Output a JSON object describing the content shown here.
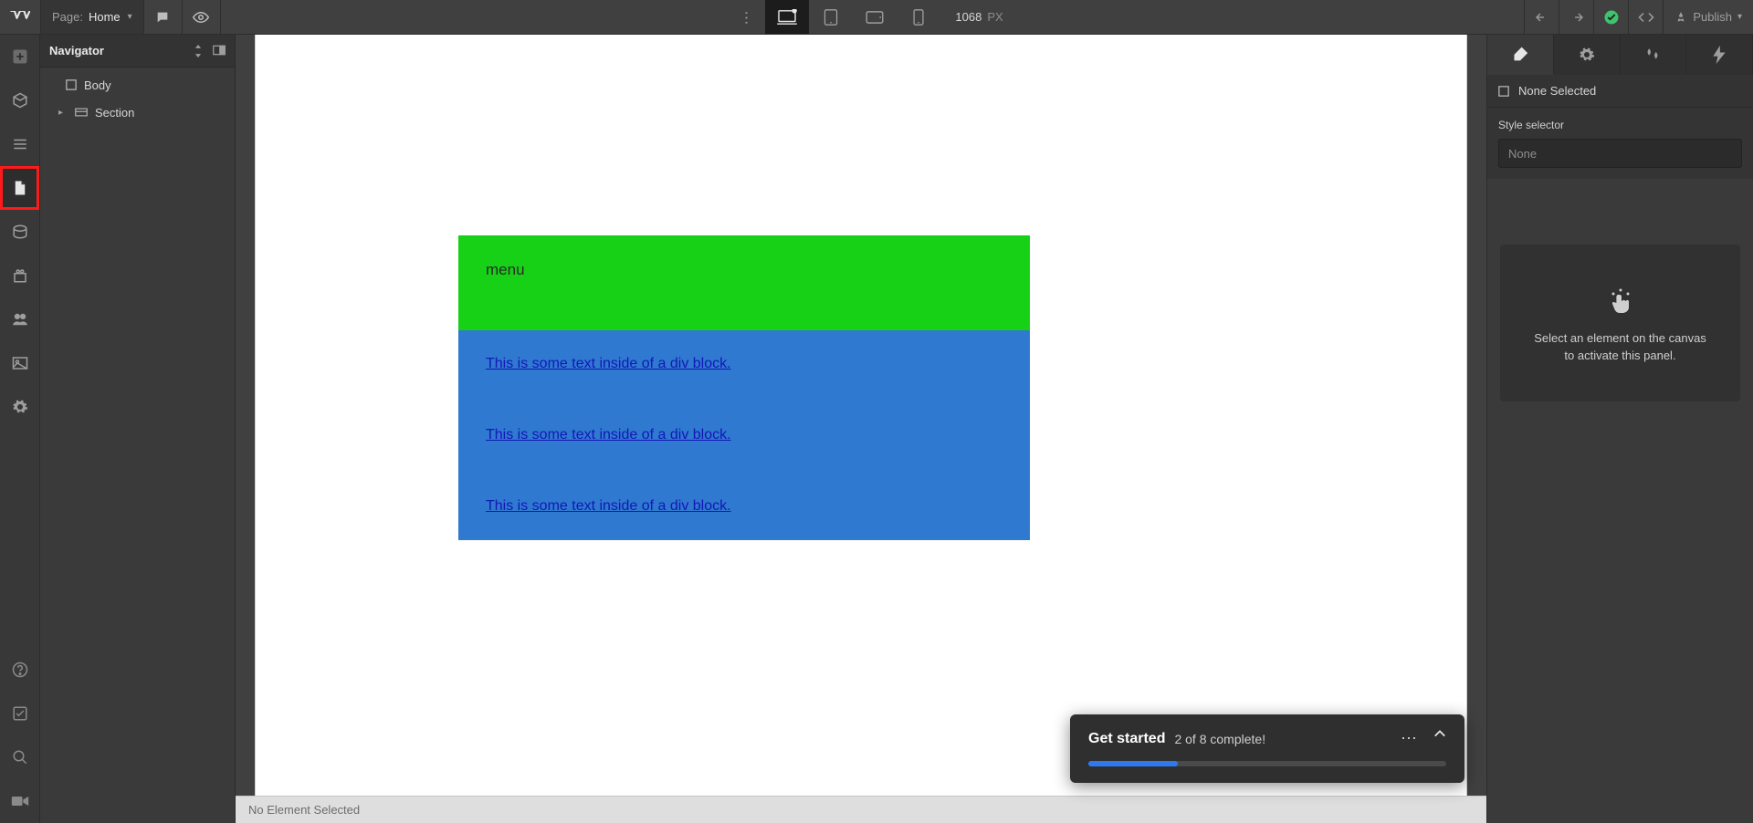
{
  "topbar": {
    "page_label": "Page:",
    "page_name": "Home",
    "width_value": "1068",
    "width_unit": "PX",
    "publish_label": "Publish"
  },
  "navigator": {
    "title": "Navigator",
    "tree": {
      "body": "Body",
      "section": "Section"
    }
  },
  "canvas": {
    "menu_label": "menu",
    "link_text": "This is some text inside of a div block.",
    "status_text": "No Element Selected"
  },
  "toast": {
    "title": "Get started",
    "subtitle": "2 of 8 complete!",
    "progress_percent": 25
  },
  "stylepanel": {
    "none_selected": "None Selected",
    "selector_label": "Style selector",
    "selector_value": "None",
    "hint_line1": "Select an element on the canvas",
    "hint_line2": "to activate this panel."
  }
}
